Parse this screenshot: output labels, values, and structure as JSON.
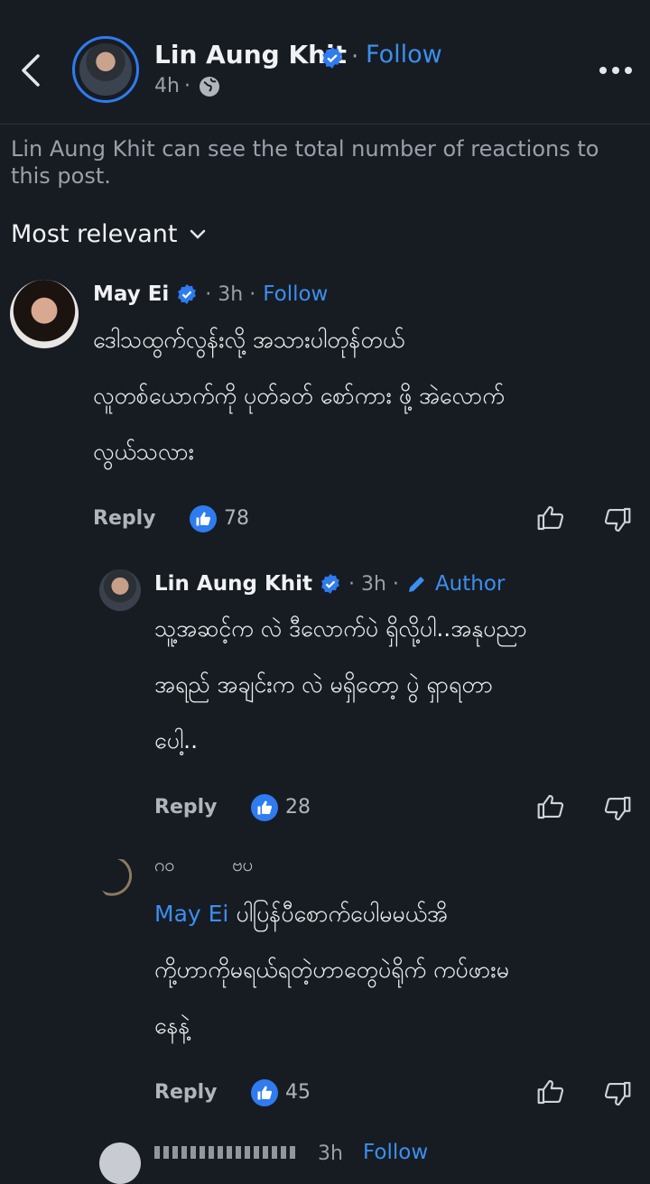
{
  "header": {
    "name": "Lin Aung Khit",
    "follow_label": "Follow",
    "separator": "·",
    "time": "4h",
    "time_suffix": "·"
  },
  "notice": "Lin Aung Khit can see the total number of reactions to this post.",
  "sort_label": "Most relevant",
  "comments": [
    {
      "name": "May Ei",
      "time": "· 3h ·",
      "follow_label": "Follow",
      "lines": [
        "ဒေါသထွက်လွန်းလို့ အသားပါတုန်တယ်",
        "လူတစ်ယောက်ကို ပုတ်ခတ် စော်ကား ဖို့ အဲလောက်",
        "လွယ်သလား"
      ],
      "reply_label": "Reply",
      "likes": "78"
    },
    {
      "name": "Lin Aung Khit",
      "time": "· 3h ·",
      "author_label": "Author",
      "lines": [
        "သူ့အဆင့်က လဲ ဒီလောက်ပဲ ရှိလို့ပါ..အနုပညာ",
        "အရည် အချင်းက လဲ မရှိတော့ ပွဲ ရှာရတာ",
        "ပေါ့.."
      ],
      "reply_label": "Reply",
      "likes": "28"
    },
    {
      "name_partial": "ဂဝ          ဗပ",
      "mention": "May Ei",
      "lines": [
        "ပါပြန်ပီစောက်ပေါမမယ်အိ",
        "ကို့ဟာကိုမရယ်ရတဲ့ဟာတွေပဲရိုက် ကပ်ဖားမ",
        "နေနဲ့"
      ],
      "reply_label": "Reply",
      "likes": "45"
    }
  ],
  "partial_bottom": {
    "time": "3h",
    "follow_label": "Follow"
  },
  "colors": {
    "background": "#171c22",
    "accent": "#3b8ff0",
    "text": "#eceef1",
    "muted": "#9aa0a8"
  }
}
